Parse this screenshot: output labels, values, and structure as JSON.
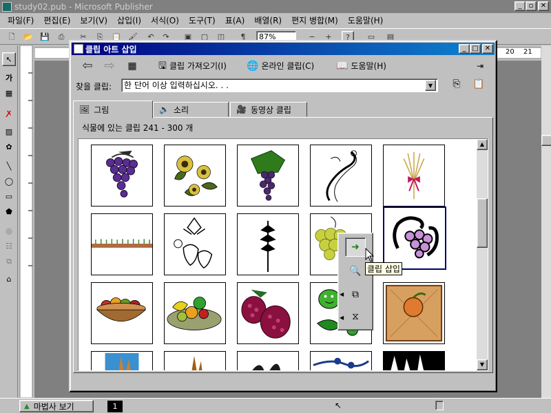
{
  "app": {
    "title": "study02.pub - Microsoft Publisher",
    "window_buttons": [
      "_",
      "▫",
      "✕"
    ]
  },
  "menu": [
    "파일(F)",
    "편집(E)",
    "보기(V)",
    "삽입(I)",
    "서식(O)",
    "도구(T)",
    "표(A)",
    "배열(R)",
    "편지 병합(M)",
    "도움말(H)"
  ],
  "toolbar": {
    "zoom": "87%"
  },
  "ruler": {
    "h_labels": [
      "20",
      "21"
    ]
  },
  "dialog": {
    "title": "클립 아트 삽입",
    "buttons": {
      "back": "⇦",
      "forward": "⇨",
      "all_categories": "▦",
      "import": "클립 가져오기(I)",
      "online": "온라인 클립(C)",
      "help": "도움말(H)"
    },
    "search": {
      "label": "찾을 클립:",
      "value": "한 단어 이상 입력하십시오. . ."
    },
    "tabs": [
      {
        "label": "그림",
        "active": true
      },
      {
        "label": "소리",
        "active": false
      },
      {
        "label": "동영상 클립",
        "active": false
      }
    ],
    "category_label": "식물에 있는 클립 241 - 300 개",
    "popup": {
      "tooltip": "클립 삽입"
    }
  },
  "status": {
    "wizard": "마법사 보기",
    "page": "1"
  },
  "colors": {
    "title_active_start": "#000080",
    "title_active_end": "#1084d0",
    "grape": "#6a3aa0",
    "raspberry": "#8a1040",
    "leaf": "#2f7a1a"
  }
}
